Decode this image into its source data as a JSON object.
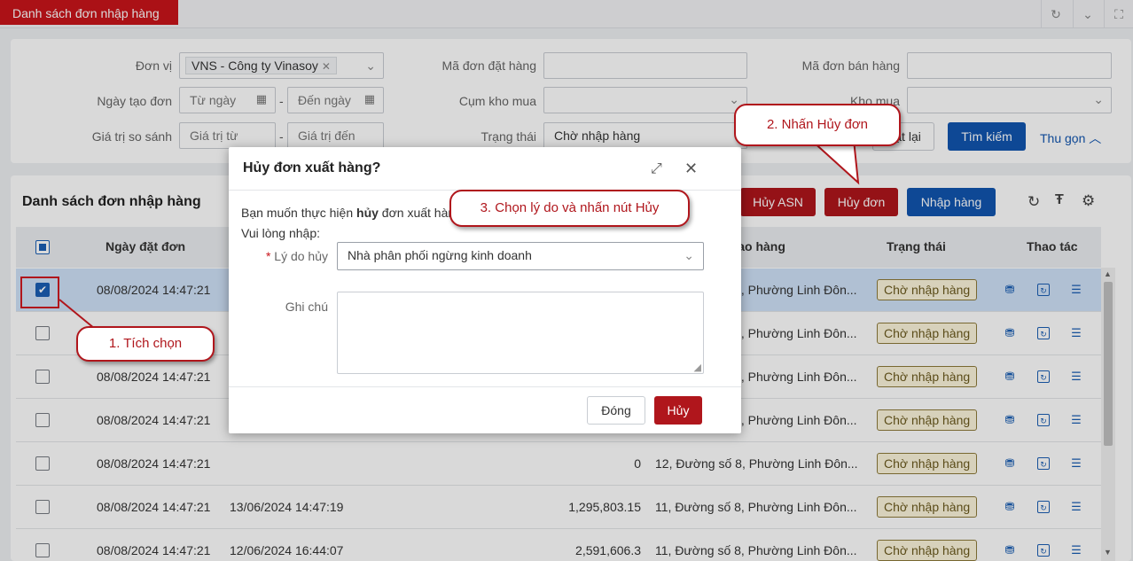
{
  "tab": {
    "title": "Danh sách đơn nhập hàng"
  },
  "filter": {
    "don_vi_label": "Đơn vị",
    "don_vi_value": "VNS - Công ty Vinasoy",
    "ngay_tao_label": "Ngày tạo đơn",
    "tu_ngay": "Từ ngày",
    "den_ngay": "Đến ngày",
    "gia_tri_label": "Giá trị so sánh",
    "gia_tri_tu": "Giá trị từ",
    "gia_tri_den": "Giá trị đến",
    "ma_don_dat_label": "Mã đơn đặt hàng",
    "cum_kho_label": "Cụm kho mua",
    "trang_thai_label": "Trạng thái",
    "trang_thai_value": "Chờ nhập hàng",
    "ma_don_ban_label": "Mã đơn bán hàng",
    "kho_mua_label": "Kho mua",
    "reset_label": "Đặt lại",
    "search_label": "Tìm kiếm",
    "collapse_label": "Thu gọn"
  },
  "list": {
    "title": "Danh sách đơn nhập hàng",
    "huy_asn": "Hủy ASN",
    "huy_don": "Hủy đơn",
    "nhap_hang": "Nhập hàng",
    "columns": [
      "Ngày đặt đơn",
      "Địa chỉ giao hàng",
      "Trạng thái",
      "Thao tác"
    ],
    "rows": [
      {
        "ngay_dat": "08/08/2024 14:47:21",
        "ngay2": "",
        "gia_tri": "",
        "dia_chi": "11, Đường số 8, Phường Linh Đôn...",
        "trang_thai": "Chờ nhập hàng"
      },
      {
        "ngay_dat": "",
        "ngay2": "",
        "gia_tri": "",
        "dia_chi": "11, Đường số 8, Phường Linh Đôn...",
        "trang_thai": "Chờ nhập hàng"
      },
      {
        "ngay_dat": "08/08/2024 14:47:21",
        "ngay2": "",
        "gia_tri": "",
        "dia_chi": "11, Đường số 8, Phường Linh Đôn...",
        "trang_thai": "Chờ nhập hàng"
      },
      {
        "ngay_dat": "08/08/2024 14:47:21",
        "ngay2": "",
        "gia_tri": "",
        "dia_chi": "11, Đường số 8, Phường Linh Đôn...",
        "trang_thai": "Chờ nhập hàng"
      },
      {
        "ngay_dat": "08/08/2024 14:47:21",
        "ngay2": "",
        "gia_tri": "0",
        "dia_chi": "12, Đường số 8, Phường Linh Đôn...",
        "trang_thai": "Chờ nhập hàng"
      },
      {
        "ngay_dat": "08/08/2024 14:47:21",
        "ngay2": "13/06/2024 14:47:19",
        "gia_tri": "1,295,803.15",
        "dia_chi": "11, Đường số 8, Phường Linh Đôn...",
        "trang_thai": "Chờ nhập hàng"
      },
      {
        "ngay_dat": "08/08/2024 14:47:21",
        "ngay2": "12/06/2024 16:44:07",
        "gia_tri": "2,591,606.3",
        "dia_chi": "11, Đường số 8, Phường Linh Đôn...",
        "trang_thai": "Chờ nhập hàng"
      }
    ]
  },
  "modal": {
    "title": "Hủy đơn xuất hàng?",
    "line1_pre": "Bạn muốn thực hiện ",
    "line1_bold": "hủy",
    "line1_post": " đơn xuất hàng?",
    "line2": "Vui lòng nhập:",
    "reason_label": "Lý do hủy",
    "reason_value": "Nhà phân phối ngừng kinh doanh",
    "note_label": "Ghi chú",
    "close_btn": "Đóng",
    "cancel_btn": "Hủy"
  },
  "callouts": {
    "c1": "1. Tích chọn",
    "c2": "2. Nhấn Hủy đơn",
    "c3": "3. Chọn lý do và nhấn nút Hủy"
  }
}
